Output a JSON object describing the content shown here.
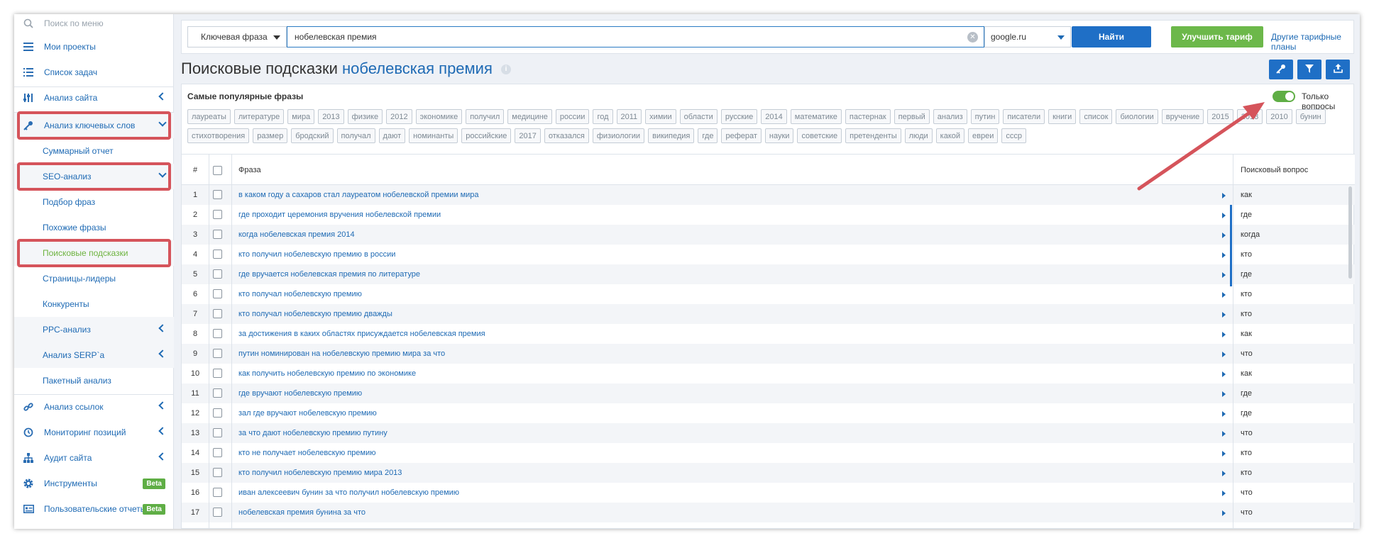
{
  "sidebar": {
    "search_placeholder": "Поиск по меню",
    "items": [
      {
        "label": "Мои проекты"
      },
      {
        "label": "Список задач"
      },
      {
        "label": "Анализ сайта"
      },
      {
        "label": "Анализ ключевых слов"
      },
      {
        "label": "Суммарный отчет"
      },
      {
        "label": "SEO-анализ"
      },
      {
        "label": "Подбор фраз"
      },
      {
        "label": "Похожие фразы"
      },
      {
        "label": "Поисковые подсказки"
      },
      {
        "label": "Страницы-лидеры"
      },
      {
        "label": "Конкуренты"
      },
      {
        "label": "PPC-анализ"
      },
      {
        "label": "Анализ SERP`a"
      },
      {
        "label": "Пакетный анализ"
      },
      {
        "label": "Анализ ссылок"
      },
      {
        "label": "Мониторинг позиций"
      },
      {
        "label": "Аудит сайта"
      },
      {
        "label": "Инструменты",
        "badge": "Beta"
      },
      {
        "label": "Пользовательские отчеты",
        "badge": "Beta"
      }
    ]
  },
  "topbar": {
    "type_select": "Ключевая фраза",
    "query": "нобелевская премия",
    "engine": "google.ru",
    "find_label": "Найти",
    "upgrade_label": "Улучшить тариф",
    "other_plans": "Другие тарифные планы"
  },
  "header": {
    "title": "Поисковые подсказки",
    "keyword": "нобелевская премия",
    "info": "i"
  },
  "popular": {
    "label": "Самые популярные фразы",
    "toggle_label": "Только вопросы",
    "toggle_on": true,
    "tags": [
      "лауреаты",
      "литературе",
      "мира",
      "2013",
      "физике",
      "2012",
      "экономике",
      "получил",
      "медицине",
      "россии",
      "год",
      "2011",
      "химии",
      "области",
      "русские",
      "2014",
      "математике",
      "пастернак",
      "первый",
      "анализ",
      "путин",
      "писатели",
      "книги",
      "список",
      "биологии",
      "вручение",
      "2015",
      "2018",
      "2010",
      "бунин",
      "стихотворения",
      "размер",
      "бродский",
      "получал",
      "дают",
      "номинанты",
      "российские",
      "2017",
      "отказался",
      "физиологии",
      "википедия",
      "где",
      "реферат",
      "науки",
      "советские",
      "претенденты",
      "люди",
      "какой",
      "евреи",
      "ссср"
    ]
  },
  "table": {
    "headers": {
      "num": "#",
      "phrase": "Фраза",
      "question": "Поисковый вопрос"
    },
    "rows": [
      {
        "n": "1",
        "phrase": "в каком году а сахаров стал лауреатом нобелевской премии мира",
        "q": "как"
      },
      {
        "n": "2",
        "phrase": "где проходит церемония вручения нобелевской премии",
        "q": "где"
      },
      {
        "n": "3",
        "phrase": "когда нобелевская премия 2014",
        "q": "когда"
      },
      {
        "n": "4",
        "phrase": "кто получил нобелевскую премию в россии",
        "q": "кто"
      },
      {
        "n": "5",
        "phrase": "где вручается нобелевская премия по литературе",
        "q": "где"
      },
      {
        "n": "6",
        "phrase": "кто получал нобелевскую премию",
        "q": "кто"
      },
      {
        "n": "7",
        "phrase": "кто получал нобелевскую премию дважды",
        "q": "кто"
      },
      {
        "n": "8",
        "phrase": "за достижения в каких областях присуждается нобелевская премия",
        "q": "как"
      },
      {
        "n": "9",
        "phrase": "путин номинирован на нобелевскую премию мира за что",
        "q": "что"
      },
      {
        "n": "10",
        "phrase": "как получить нобелевскую премию по экономике",
        "q": "как"
      },
      {
        "n": "11",
        "phrase": "где вручают нобелевскую премию",
        "q": "где"
      },
      {
        "n": "12",
        "phrase": "зал где вручают нобелевскую премию",
        "q": "где"
      },
      {
        "n": "13",
        "phrase": "за что дают нобелевскую премию путину",
        "q": "что"
      },
      {
        "n": "14",
        "phrase": "кто не получает нобелевскую премию",
        "q": "кто"
      },
      {
        "n": "15",
        "phrase": "кто получил нобелевскую премию мира 2013",
        "q": "кто"
      },
      {
        "n": "16",
        "phrase": "иван алексеевич бунин за что получил нобелевскую премию",
        "q": "что"
      },
      {
        "n": "17",
        "phrase": "нобелевская премия бунина за что",
        "q": "что"
      }
    ]
  },
  "colors": {
    "accent": "#1f6fc6",
    "green": "#6cb84a",
    "highlight": "#d5545b"
  }
}
